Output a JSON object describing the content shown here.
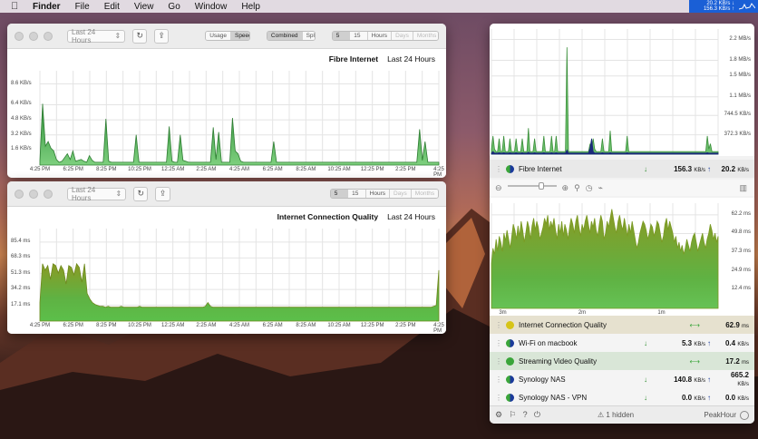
{
  "menubar": {
    "apple": "",
    "items": [
      "Finder",
      "File",
      "Edit",
      "View",
      "Go",
      "Window",
      "Help"
    ],
    "status_down": "20.2 KB/s",
    "status_up": "156.3 KB/s"
  },
  "window1": {
    "range": "Last 24 Hours",
    "view_seg": [
      "Usage",
      "Speed"
    ],
    "view_selected": "Speed",
    "mode_seg": [
      "Combined",
      "Split"
    ],
    "mode_selected": "Combined",
    "interval_seg": [
      "5 Min",
      "15 Min",
      "Hours",
      "Days",
      "Months"
    ],
    "interval_selected": "5 Min",
    "title": "Fibre Internet",
    "period": "Last 24 Hours"
  },
  "window2": {
    "range": "Last 24 Hours",
    "interval_seg": [
      "5 Min",
      "15 Min",
      "Hours",
      "Days",
      "Months"
    ],
    "interval_selected": "5 Min",
    "title": "Internet Connection Quality",
    "period": "Last 24 Hours"
  },
  "colors": {
    "green_fill": "#4caa4c",
    "green_dark": "#2e7d32",
    "olive": "#8a9a24",
    "navy": "#1b2a7a",
    "blue_menu": "#1a5fd6"
  },
  "chart_data": [
    {
      "type": "area",
      "title": "Fibre Internet",
      "xlabel": "",
      "ylabel": "",
      "yticks": [
        "8.6 KB/s",
        "6.4 KB/s",
        "4.8 KB/s",
        "3.2 KB/s",
        "1.6 KB/s"
      ],
      "ytick_values": [
        8.6,
        6.4,
        4.8,
        3.2,
        1.6
      ],
      "ylim": [
        0,
        10
      ],
      "xticks": [
        "4:25 PM",
        "6:25 PM",
        "8:25 PM",
        "10:25 PM",
        "12:25 AM",
        "2:25 AM",
        "4:25 AM",
        "6:25 AM",
        "8:25 AM",
        "10:25 AM",
        "12:25 PM",
        "2:25 PM",
        "4:25 PM"
      ],
      "series": [
        {
          "values": [
            0.5,
            6.5,
            2.0,
            2.5,
            1.8,
            1.5,
            0.6,
            0.3,
            0.4,
            0.8,
            1.2,
            0.6,
            1.5,
            0.4,
            0.5,
            0.6,
            0.4,
            0.3,
            1.0,
            0.5,
            0.3,
            0.3,
            0.3,
            0.3,
            4.9,
            0.4,
            0.3,
            0.3,
            0.3,
            0.3,
            0.3,
            0.3,
            0.3,
            0.3,
            0.3,
            3.2,
            0.3,
            0.3,
            0.3,
            0.3,
            0.3,
            0.3,
            0.3,
            0.3,
            0.3,
            0.3,
            0.3,
            4.1,
            0.4,
            0.3,
            0.3,
            3.2,
            0.5,
            0.4,
            0.3,
            0.3,
            0.3,
            0.3,
            0.3,
            0.3,
            0.3,
            0.3,
            0.3,
            4.0,
            0.6,
            3.5,
            0.3,
            0.3,
            0.3,
            0.3,
            5.0,
            1.5,
            1.2,
            0.4,
            0.3,
            0.3,
            0.3,
            0.3,
            0.3,
            0.3,
            0.3,
            0.3,
            0.3,
            0.3,
            0.3,
            2.5,
            0.3,
            0.3,
            0.3,
            0.3,
            0.3,
            0.3,
            0.3,
            0.3,
            0.3,
            0.3,
            0.3,
            0.3,
            0.3,
            0.3,
            0.3,
            0.3,
            0.3,
            0.3,
            0.3,
            0.3,
            0.3,
            0.3,
            0.3,
            0.3,
            0.3,
            0.3,
            0.3,
            0.3,
            0.3,
            0.3,
            0.3,
            0.3,
            0.3,
            0.3,
            0.3,
            0.3,
            0.3,
            0.3,
            0.3,
            0.3,
            0.3,
            0.3,
            0.3,
            0.3,
            0.3,
            0.3,
            0.3,
            0.3,
            0.3,
            0.3,
            0.3,
            0.3,
            3.8,
            0.5,
            2.5,
            0.3,
            0.3,
            0.3,
            0.3,
            0.3
          ]
        }
      ]
    },
    {
      "type": "area",
      "title": "Internet Connection Quality",
      "xlabel": "",
      "ylabel": "",
      "yticks": [
        "85.4 ms",
        "68.3 ms",
        "51.3 ms",
        "34.2 ms",
        "17.1 ms"
      ],
      "ytick_values": [
        85.4,
        68.3,
        51.3,
        34.2,
        17.1
      ],
      "ylim": [
        0,
        100
      ],
      "xticks": [
        "4:25 PM",
        "6:25 PM",
        "8:25 PM",
        "10:25 PM",
        "12:25 AM",
        "2:25 AM",
        "4:25 AM",
        "6:25 AM",
        "8:25 AM",
        "10:25 AM",
        "12:25 PM",
        "2:25 PM",
        "4:25 PM"
      ],
      "series": [
        {
          "values": [
            20,
            62,
            55,
            60,
            45,
            62,
            60,
            52,
            60,
            55,
            40,
            60,
            58,
            50,
            62,
            58,
            42,
            62,
            30,
            24,
            20,
            18,
            17,
            16,
            16,
            15,
            16,
            15,
            15,
            15,
            15,
            16,
            15,
            15,
            15,
            15,
            15,
            15,
            16,
            15,
            15,
            15,
            15,
            15,
            15,
            15,
            15,
            15,
            15,
            15,
            15,
            15,
            15,
            15,
            15,
            15,
            15,
            15,
            15,
            15,
            15,
            15,
            15,
            16,
            20,
            16,
            15,
            15,
            15,
            15,
            15,
            15,
            15,
            15,
            15,
            15,
            15,
            15,
            15,
            15,
            15,
            15,
            15,
            15,
            15,
            15,
            15,
            15,
            15,
            15,
            15,
            15,
            15,
            15,
            15,
            15,
            15,
            15,
            15,
            15,
            15,
            15,
            15,
            15,
            15,
            15,
            15,
            15,
            15,
            15,
            15,
            15,
            15,
            15,
            15,
            15,
            15,
            15,
            15,
            15,
            15,
            15,
            15,
            15,
            15,
            15,
            15,
            15,
            15,
            15,
            15,
            15,
            15,
            15,
            15,
            15,
            15,
            15,
            15,
            15,
            15,
            15,
            15,
            15,
            15,
            15,
            15,
            15,
            15,
            15,
            16,
            17,
            55
          ]
        }
      ]
    },
    {
      "type": "area",
      "title": "Fibre Internet",
      "yticks": [
        "2.2 MB/s",
        "1.8 MB/s",
        "1.5 MB/s",
        "1.1 MB/s",
        "744.5 KB/s",
        "372.3 KB/s"
      ],
      "ytick_values": [
        2.2,
        1.8,
        1.5,
        1.1,
        0.7445,
        0.3723
      ],
      "ylim": [
        0,
        2.4
      ],
      "series": [
        {
          "values": [
            0.1,
            0.35,
            0.1,
            0.05,
            0.05,
            0.3,
            0.05,
            0.05,
            0.35,
            0.05,
            0.05,
            0.05,
            0.3,
            0.05,
            0.05,
            0.05,
            0.3,
            0.05,
            0.05,
            0.05,
            0.3,
            0.05,
            0.05,
            0.05,
            0.5,
            0.05,
            0.05,
            0.05,
            0.3,
            0.05,
            0.05,
            0.05,
            0.05,
            0.05,
            0.35,
            0.05,
            0.05,
            0.05,
            0.05,
            0.35,
            0.05,
            0.05,
            0.35,
            0.05,
            0.05,
            0.05,
            0.05,
            0.05,
            0.05,
            2.05,
            0.05,
            0.05,
            0.05,
            0.05,
            0.05,
            0.05,
            0.05,
            0.05,
            0.05,
            0.05,
            0.05,
            0.05,
            0.05,
            0.05,
            0.2,
            0.1,
            0.3,
            0.1,
            0.05,
            0.05,
            0.05,
            0.05,
            0.3,
            0.05,
            0.05,
            0.05,
            0.05,
            0.45,
            0.05,
            0.05,
            0.05,
            0.05,
            0.05,
            0.05,
            0.05,
            0.05,
            0.05,
            0.05,
            0.35,
            0.05,
            0.05,
            0.05,
            0.05,
            0.05,
            0.05,
            0.05,
            0.05,
            0.05,
            0.05,
            0.05,
            0.05,
            0.05,
            0.05,
            0.05,
            0.05,
            0.05,
            0.05,
            0.05,
            0.05,
            0.05,
            0.05,
            0.05,
            0.05,
            0.05,
            0.05,
            0.05,
            0.05,
            0.05,
            0.05,
            0.05,
            0.05,
            0.05,
            0.05,
            0.05,
            0.05,
            0.05,
            0.05,
            0.05,
            0.05,
            0.05,
            0.05,
            0.05,
            0.05,
            0.05,
            0.05,
            0.05,
            0.05,
            0.05,
            0.05,
            0.05,
            0.35,
            0.1,
            0.2,
            0.05,
            0.05,
            0.05,
            0.05,
            0.05
          ]
        },
        {
          "values": [
            0.02,
            0.05,
            0.02,
            0.02,
            0.02,
            0.03,
            0.02,
            0.02,
            0.03,
            0.02,
            0.02,
            0.02,
            0.03,
            0.02,
            0.02,
            0.02,
            0.03,
            0.02,
            0.02,
            0.02,
            0.03,
            0.02,
            0.02,
            0.02,
            0.04,
            0.02,
            0.02,
            0.02,
            0.03,
            0.02,
            0.02,
            0.02,
            0.02,
            0.02,
            0.03,
            0.02,
            0.02,
            0.02,
            0.02,
            0.03,
            0.02,
            0.02,
            0.03,
            0.02,
            0.02,
            0.02,
            0.02,
            0.02,
            0.02,
            0.08,
            0.02,
            0.02,
            0.02,
            0.02,
            0.02,
            0.02,
            0.02,
            0.02,
            0.02,
            0.02,
            0.02,
            0.02,
            0.02,
            0.02,
            0.12,
            0.3,
            0.05,
            0.02,
            0.02,
            0.02,
            0.02,
            0.02,
            0.03,
            0.02,
            0.02,
            0.02,
            0.02,
            0.03,
            0.02,
            0.02,
            0.02,
            0.02,
            0.02,
            0.02,
            0.02,
            0.02,
            0.02,
            0.02,
            0.03,
            0.02,
            0.02,
            0.02,
            0.02,
            0.02,
            0.02,
            0.02,
            0.02,
            0.02,
            0.02,
            0.02,
            0.02,
            0.02,
            0.02,
            0.02,
            0.02,
            0.02,
            0.02,
            0.02,
            0.02,
            0.02,
            0.02,
            0.02,
            0.02,
            0.02,
            0.02,
            0.02,
            0.02,
            0.02,
            0.02,
            0.02,
            0.02,
            0.02,
            0.02,
            0.02,
            0.02,
            0.02,
            0.02,
            0.02,
            0.02,
            0.02,
            0.02,
            0.02,
            0.02,
            0.02,
            0.02,
            0.02,
            0.02,
            0.02,
            0.02,
            0.02,
            0.03,
            0.02,
            0.02,
            0.02,
            0.02,
            0.02,
            0.02,
            0.02
          ]
        }
      ]
    },
    {
      "type": "area",
      "title": "Internet Connection Quality",
      "yticks": [
        "62.2 ms",
        "49.8 ms",
        "37.3 ms",
        "24.9 ms",
        "12.4 ms"
      ],
      "ytick_values": [
        62.2,
        49.8,
        37.3,
        24.9,
        12.4
      ],
      "ylim": [
        0,
        70
      ],
      "xticks": [
        "3m",
        "2m",
        "1m"
      ],
      "series": [
        {
          "values": [
            30,
            40,
            36,
            46,
            38,
            48,
            44,
            38,
            50,
            45,
            52,
            46,
            40,
            48,
            56,
            52,
            46,
            55,
            48,
            58,
            52,
            44,
            50,
            58,
            54,
            46,
            55,
            60,
            52,
            58,
            54,
            46,
            50,
            54,
            60,
            56,
            62,
            52,
            58,
            54,
            60,
            52,
            46,
            56,
            50,
            58,
            48,
            56,
            52,
            46,
            54,
            60,
            56,
            50,
            58,
            62,
            54,
            48,
            56,
            52,
            58,
            62,
            56,
            50,
            58,
            54,
            60,
            52,
            48,
            56,
            62,
            58,
            46,
            50,
            58,
            54,
            60,
            66,
            60,
            54,
            50,
            58,
            62,
            56,
            52,
            60,
            54,
            48,
            56,
            50,
            58,
            52,
            46,
            40,
            44,
            50,
            54,
            58,
            56,
            52,
            46,
            50,
            56,
            54,
            48,
            52,
            58,
            56,
            50,
            44,
            48,
            56,
            60,
            52,
            58,
            54,
            50,
            44,
            48,
            40,
            44,
            38,
            42,
            36,
            40,
            46,
            42,
            38,
            44,
            48,
            50,
            44,
            38,
            42,
            46,
            50,
            44,
            40,
            46,
            50,
            56,
            52,
            46,
            50,
            44,
            48
          ]
        }
      ]
    }
  ],
  "panel": {
    "rows": [
      {
        "name": "Fibre Internet",
        "v1": "156.3",
        "u1": "KB/s",
        "v2": "20.2",
        "u2": "KB/s",
        "dot": "pie"
      },
      {
        "name": "Internet Connection Quality",
        "v1": "62.9",
        "u1": "ms",
        "dot": "yellow"
      },
      {
        "name": "Wi-Fi on macbook",
        "v1": "5.3",
        "u1": "KB/s",
        "v2": "0.4",
        "u2": "KB/s",
        "dot": "pie"
      },
      {
        "name": "Streaming Video Quality",
        "v1": "17.2",
        "u1": "ms",
        "dot": "green"
      },
      {
        "name": "Synology NAS",
        "v1": "140.8",
        "u1": "KB/s",
        "v2": "665.2",
        "u2": "KB/s",
        "dot": "pie"
      },
      {
        "name": "Synology NAS - VPN",
        "v1": "0.0",
        "u1": "KB/s",
        "v2": "0.0",
        "u2": "KB/s",
        "dot": "pie"
      }
    ],
    "hidden_label": "1 hidden",
    "brand": "PeakHour"
  }
}
